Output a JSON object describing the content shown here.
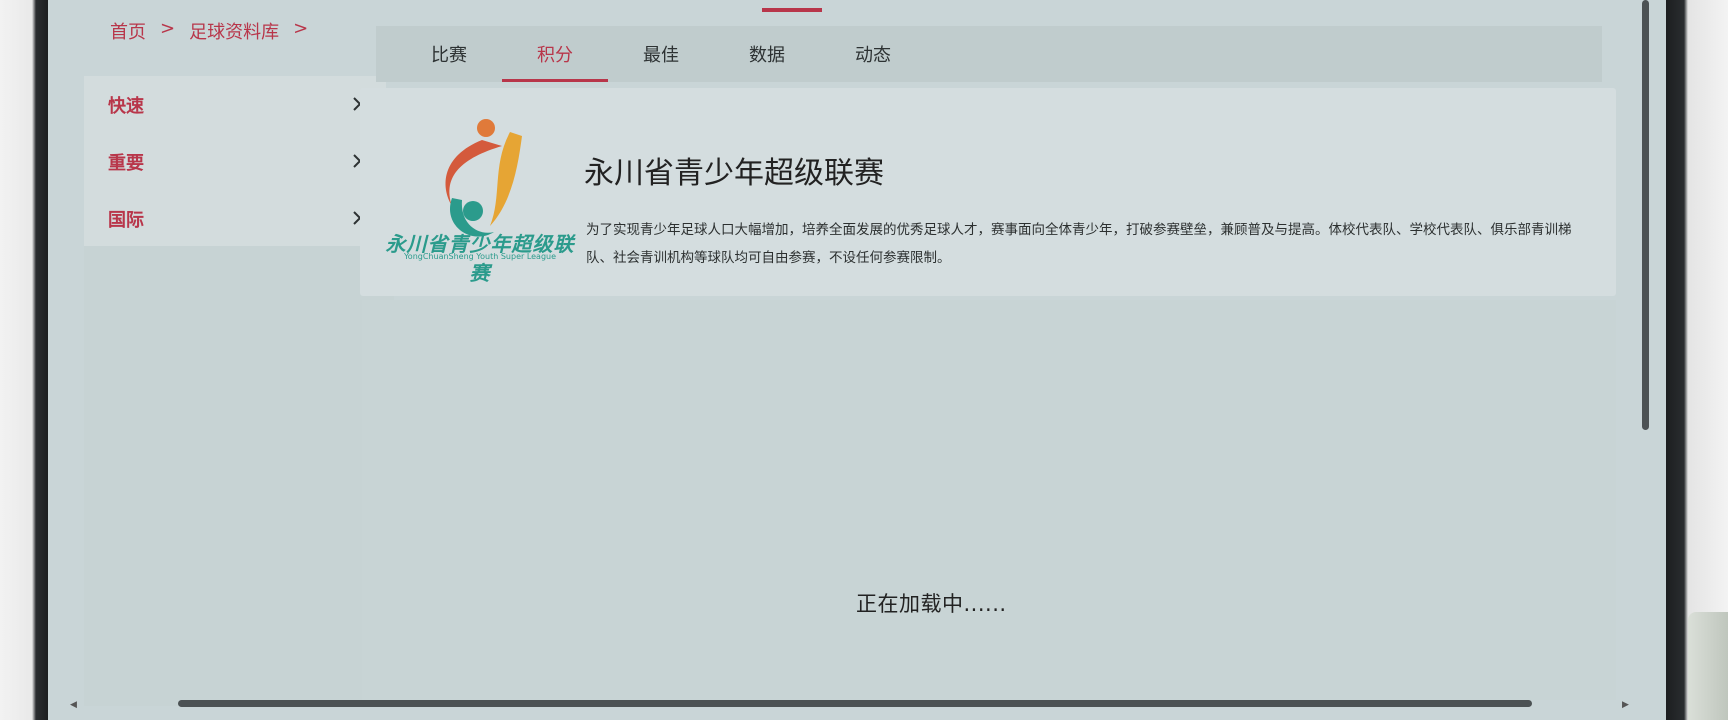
{
  "breadcrumb": {
    "home": "首页",
    "sep1": ">",
    "library": "足球资料库",
    "sep2": ">"
  },
  "left_menu": [
    {
      "label": "快速",
      "icon": "chevron-right-icon"
    },
    {
      "label": "重要",
      "icon": "chevron-right-icon"
    },
    {
      "label": "国际",
      "icon": "chevron-right-icon"
    }
  ],
  "tabs": [
    {
      "label": "比赛",
      "active": false
    },
    {
      "label": "积分",
      "active": true
    },
    {
      "label": "最佳",
      "active": false
    },
    {
      "label": "数据",
      "active": false
    },
    {
      "label": "动态",
      "active": false
    }
  ],
  "league": {
    "logo_text": "永川省青少年超级联赛",
    "logo_subtext": "YongChuanSheng Youth Super League",
    "title": "永川省青少年超级联赛",
    "description": "为了实现青少年足球人口大幅增加，培养全面发展的优秀足球人才，赛事面向全体青少年，打破参赛壁垒，兼顾普及与提高。体校代表队、学校代表队、俱乐部青训梯队、社会青训机构等球队均可自由参赛，不设任何参赛限制。"
  },
  "status": {
    "loading": "正在加载中......"
  },
  "colors": {
    "accent": "#b8364a",
    "logo_teal": "#2b9b8c",
    "screen_bg": "#c9d5d7"
  }
}
